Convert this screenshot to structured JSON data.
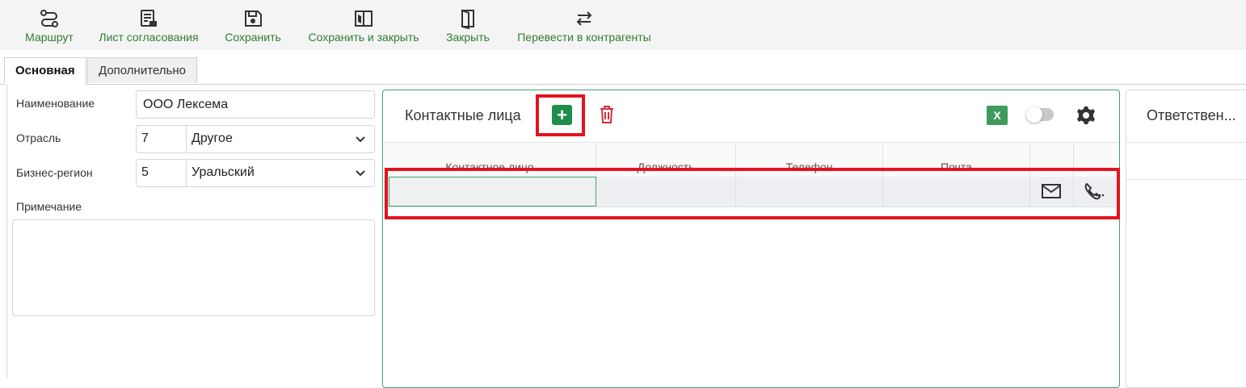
{
  "toolbar": {
    "route": "Маршрут",
    "approval_sheet": "Лист согласования",
    "save": "Сохранить",
    "save_close": "Сохранить и закрыть",
    "close": "Закрыть",
    "convert": "Перевести в контрагенты"
  },
  "tabs": {
    "main": "Основная",
    "extra": "Дополнительно"
  },
  "form": {
    "name_label": "Наименование",
    "name_value": "ООО Лексема",
    "industry_label": "Отрасль",
    "industry_code": "7",
    "industry_value": "Другое",
    "region_label": "Бизнес-регион",
    "region_code": "5",
    "region_value": "Уральский",
    "note_label": "Примечание"
  },
  "contacts": {
    "title": "Контактные лица",
    "excel_label": "X",
    "columns": [
      "Контактное лицо",
      "Должность",
      "Телефон",
      "Почта"
    ]
  },
  "responsible": {
    "title": "Ответствен..."
  },
  "colors": {
    "accent_green": "#2e7d32",
    "highlight_red": "#e3141e",
    "delete_red": "#d32f3f"
  }
}
